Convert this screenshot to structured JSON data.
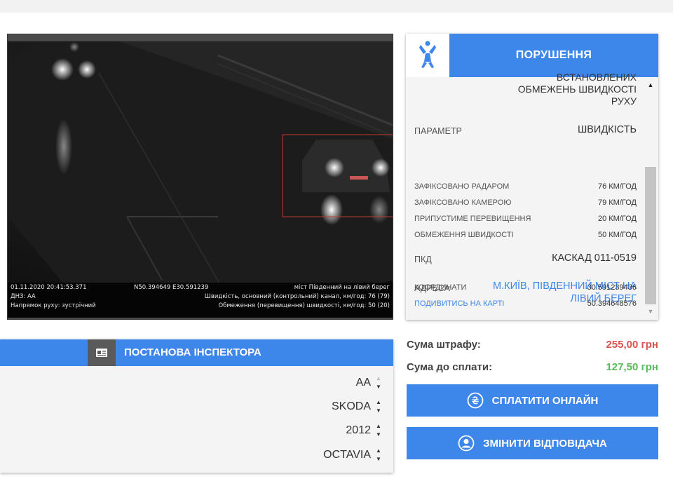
{
  "camera": {
    "datetime": "01.11.2020 20:41:53.371",
    "gps": "N50.394649 E30.591239",
    "location": "міст Південний на лівий берег",
    "plate": "ДНЗ: АА",
    "speed_line": "Швидкість, основний (контрольний) канал, км/год: 76 (79)",
    "direction": "Напрямок руху: зустрічний",
    "limit_line": "Обмеження (перевищення) швидкості, км/год: 50 (20)"
  },
  "violation": {
    "title": "ПОРУШЕННЯ",
    "desc": [
      "ВСТАНОВЛЕНИХ",
      "ОБМЕЖЕНЬ ШВИДКОСТІ",
      "РУХУ"
    ],
    "param_label": "ПАРАМЕТР",
    "param_value": "ШВИДКІСТЬ",
    "rows": [
      {
        "label": "ЗАФІКСОВАНО РАДАРОМ",
        "value": "76 КМ/ГОД"
      },
      {
        "label": "ЗАФІКСОВАНО КАМЕРОЮ",
        "value": "79 КМ/ГОД"
      },
      {
        "label": "ПРИПУСТИМЕ ПЕРЕВИЩЕННЯ",
        "value": "20 КМ/ГОД"
      },
      {
        "label": "ОБМЕЖЕННЯ ШВИДКОСТІ",
        "value": "50 КМ/ГОД"
      }
    ],
    "pkd_label": "ПКД",
    "pkd_value": "КАСКАД 011-0519",
    "address_label": "АДРЕСА",
    "address_line1": "М.КИЇВ, ПІВДЕННИЙ МІСТ НА",
    "address_line2": "ЛІВИЙ БЕРЕГ",
    "coords_label": "КООРДИНАТИ",
    "coord_lon": "30.591239436",
    "map_link": "ПОДИВИТИСЬ НА КАРТІ",
    "coord_lat": "50.394648576",
    "accent_color": "#3d86ea",
    "link_color": "#3d86ea"
  },
  "inspector": {
    "title": "ПОСТАНОВА ІНСПЕКТОРА",
    "fields": [
      "АА",
      "SKODA",
      "2012",
      "OCTAVIA"
    ]
  },
  "fine": {
    "amount_label": "Сума штрафу:",
    "amount_value": "255,00 грн",
    "amount_color": "#d9534f",
    "due_label": "Сума до сплати:",
    "due_value": "127,50 грн",
    "due_color": "#5cb85c"
  },
  "buttons": {
    "pay": "СПЛАТИТИ ОНЛАЙН",
    "change": "ЗМІНИТИ ВІДПОВІДАЧА"
  },
  "icons": [
    "logo-icon",
    "id-card-icon",
    "hryvnia-icon",
    "user-icon"
  ]
}
